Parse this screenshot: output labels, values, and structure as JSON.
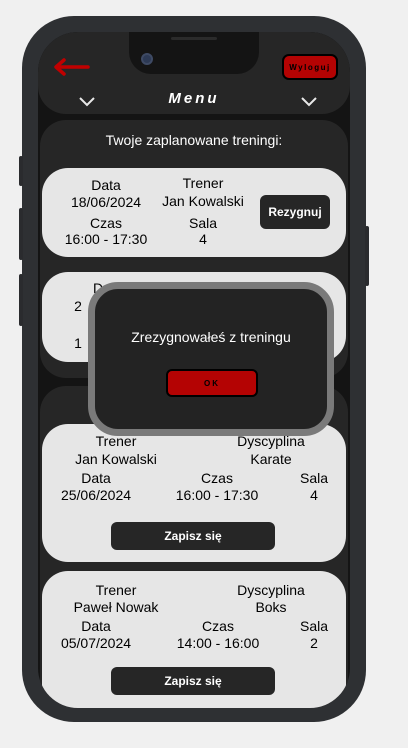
{
  "header": {
    "back_icon": "arrow-left-icon",
    "logout_label": "Wyloguj",
    "menu_title": "Menu",
    "chevron_icon": "chevron-down-icon"
  },
  "colors": {
    "accent_red": "#b40303",
    "panel_dark": "#262626",
    "card_light": "#e6e6e6"
  },
  "planned": {
    "title": "Twoje zaplanowane treningi:",
    "items": [
      {
        "date_label": "Data",
        "date": "18/06/2024",
        "trainer_label": "Trener",
        "trainer": "Jan Kowalski",
        "time_label": "Czas",
        "time": "16:00 - 17:30",
        "room_label": "Sala",
        "room": "4",
        "button": "Rezygnuj"
      },
      {
        "date_label": "D",
        "date": "2",
        "time_label": "",
        "time": "1",
        "trainer_label": "T"
      }
    ]
  },
  "available": {
    "items": [
      {
        "trainer_label": "Trener",
        "trainer": "Jan Kowalski",
        "discipline_label": "Dyscyplina",
        "discipline": "Karate",
        "date_label": "Data",
        "date": "25/06/2024",
        "time_label": "Czas",
        "time": "16:00 - 17:30",
        "room_label": "Sala",
        "room": "4",
        "button": "Zapisz się"
      },
      {
        "trainer_label": "Trener",
        "trainer": "Paweł Nowak",
        "discipline_label": "Dyscyplina",
        "discipline": "Boks",
        "date_label": "Data",
        "date": "05/07/2024",
        "time_label": "Czas",
        "time": "14:00 - 16:00",
        "room_label": "Sala",
        "room": "2",
        "button": "Zapisz się"
      }
    ]
  },
  "modal": {
    "message": "Zrezygnowałeś z treningu",
    "ok_label": "OK"
  }
}
